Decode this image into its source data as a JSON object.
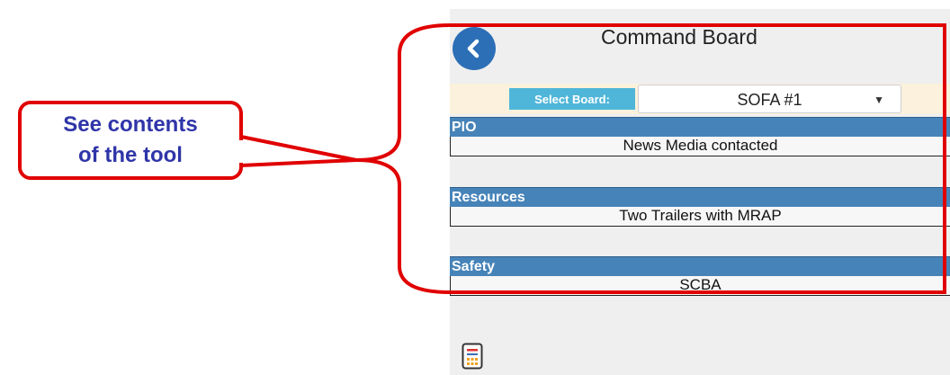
{
  "callout": {
    "line1": "See contents",
    "line2": "of the tool"
  },
  "header": {
    "title": "Command Board",
    "back_icon": "chevron-left-icon"
  },
  "board_select": {
    "label": "Select Board:",
    "value": "SOFA #1",
    "caret": "▼"
  },
  "sections": [
    {
      "title": "PIO",
      "content": "News Media contacted"
    },
    {
      "title": "Resources",
      "content": "Two Trailers with MRAP"
    },
    {
      "title": "Safety",
      "content": "SCBA"
    }
  ],
  "footer": {
    "tool_icon": "calculator-icon"
  },
  "colors": {
    "accent_blue": "#4683b8",
    "back_button": "#2c6fb6",
    "select_label_bg": "#4fb6d9",
    "highlight_red": "#e00000",
    "callout_text": "#2f35a8"
  }
}
